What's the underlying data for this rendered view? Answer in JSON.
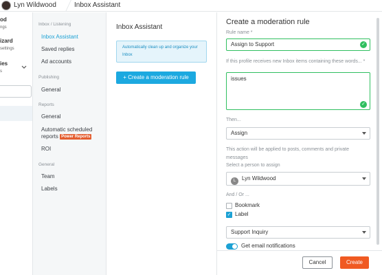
{
  "topbar": {
    "user_name": "Lyn Wildwood",
    "page_title": "Inbox Assistant"
  },
  "left_partial": {
    "item1": "od",
    "item1_sub": "ngs",
    "item2": "izard",
    "item2_sub": "settings",
    "item3": "ies",
    "item3_sub": "s"
  },
  "nav": {
    "section1": "Inbox / Listening",
    "inbox_assistant": "Inbox Assistant",
    "saved_replies": "Saved replies",
    "ad_accounts": "Ad accounts",
    "section2": "Publishing",
    "publishing_general": "General",
    "section3": "Reports",
    "reports_general": "General",
    "auto_reports_line1": "Automatic scheduled",
    "auto_reports_line2": "reports",
    "power_badge": "Power Reports",
    "roi": "ROI",
    "section4": "General",
    "team": "Team",
    "labels": "Labels"
  },
  "middle": {
    "title": "Inbox Assistant",
    "tip": "Automatically clean up and organize your Inbox",
    "create_button": "+ Create a moderation rule"
  },
  "form": {
    "title": "Create a moderation rule",
    "rule_name_label": "Rule name *",
    "rule_name_value": "Assign to Support",
    "words_label": "If this profile receives new Inbox items containing these words... *",
    "words_value": "issues",
    "then_label": "Then...",
    "then_value": "Assign",
    "action_note": "This action will be applied to posts, comments and private messages",
    "person_label": "Select a person to assign",
    "person_initial": "L",
    "person_value": "Lyn Wildwood",
    "andor_label": "And / Or ...",
    "bookmark_label": "Bookmark",
    "label_label": "Label",
    "label_value": "Support Inquiry",
    "email_label": "Get email notifications",
    "cancel": "Cancel",
    "create": "Create"
  }
}
